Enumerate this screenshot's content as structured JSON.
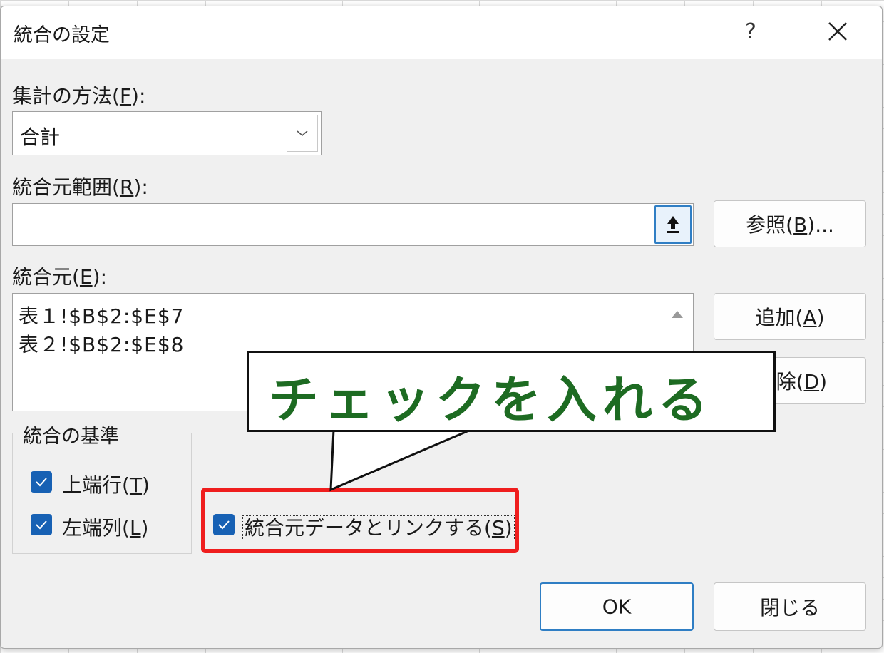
{
  "dialog": {
    "title": "統合の設定",
    "help_label": "?"
  },
  "function": {
    "label_prefix": "集計の方法(",
    "label_key": "F",
    "label_suffix": "):",
    "selected": "合計"
  },
  "reference": {
    "label_prefix": "統合元範囲(",
    "label_key": "R",
    "label_suffix": "):",
    "value": "",
    "browse_prefix": "参照(",
    "browse_key": "B",
    "browse_suffix": ")..."
  },
  "all_references": {
    "label_prefix": "統合元(",
    "label_key": "E",
    "label_suffix": "):",
    "items": [
      "表１!$B$2:$E$7",
      "表２!$B$2:$E$8"
    ],
    "add_prefix": "追加(",
    "add_key": "A",
    "add_suffix": ")",
    "delete_visible_prefix": "除(",
    "delete_key": "D",
    "delete_suffix": ")"
  },
  "use_labels": {
    "legend": "統合の基準",
    "top_row_prefix": "上端行(",
    "top_row_key": "T",
    "top_row_suffix": ")",
    "top_row_checked": true,
    "left_col_prefix": "左端列(",
    "left_col_key": "L",
    "left_col_suffix": ")",
    "left_col_checked": true
  },
  "links": {
    "label_prefix": "統合元データとリンクする(",
    "label_key": "S",
    "label_suffix": ")",
    "checked": true
  },
  "annotation": {
    "callout_text": "チェックを入れる",
    "highlight_color": "#ef1e1e",
    "text_color": "#1d6b22"
  },
  "footer": {
    "ok_label": "OK",
    "close_label": "閉じる"
  },
  "colors": {
    "checkbox": "#1761b4",
    "accent": "#2f7ec4"
  }
}
